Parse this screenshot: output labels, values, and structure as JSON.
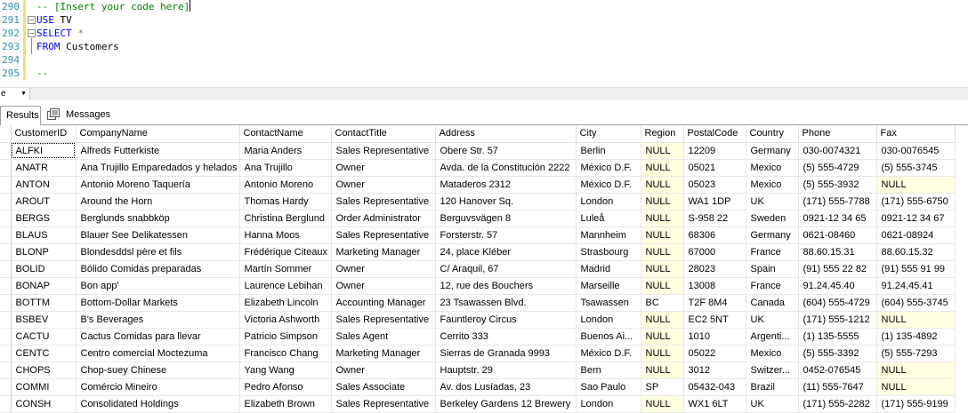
{
  "editor": {
    "lines": [
      {
        "num": "290",
        "parts": [
          {
            "t": "-- [Insert your code here]",
            "c": "cm"
          }
        ],
        "caret": true
      },
      {
        "num": "291",
        "parts": [
          {
            "t": "USE",
            "c": "kw"
          },
          {
            "t": " TV",
            "c": "tx"
          }
        ]
      },
      {
        "num": "292",
        "parts": [
          {
            "t": "SELECT",
            "c": "kw"
          },
          {
            "t": " ",
            "c": "tx"
          },
          {
            "t": "*",
            "c": "op"
          }
        ]
      },
      {
        "num": "293",
        "parts": [
          {
            "t": "FROM",
            "c": "kw"
          },
          {
            "t": " Customers",
            "c": "tx"
          }
        ]
      },
      {
        "num": "294",
        "parts": []
      },
      {
        "num": "295",
        "parts": [
          {
            "t": "--",
            "c": "cm"
          }
        ]
      }
    ],
    "gutter_color": "#f0df79"
  },
  "zoom": {
    "value": "e"
  },
  "tabs": {
    "results_label": "Results",
    "messages_label": "Messages"
  },
  "grid": {
    "columns": [
      "CustomerID",
      "CompanyName",
      "ContactName",
      "ContactTitle",
      "Address",
      "City",
      "Region",
      "PostalCode",
      "Country",
      "Phone",
      "Fax"
    ],
    "rows": [
      [
        "ALFKI",
        "Alfreds Futterkiste",
        "Maria Anders",
        "Sales Representative",
        "Obere Str. 57",
        "Berlin",
        "NULL",
        "12209",
        "Germany",
        "030-0074321",
        "030-0076545"
      ],
      [
        "ANATR",
        "Ana Trujillo Emparedados y helados",
        "Ana Trujillo",
        "Owner",
        "Avda. de la Constitución 2222",
        "México D.F.",
        "NULL",
        "05021",
        "Mexico",
        "(5) 555-4729",
        "(5) 555-3745"
      ],
      [
        "ANTON",
        "Antonio Moreno Taquería",
        "Antonio Moreno",
        "Owner",
        "Mataderos  2312",
        "México D.F.",
        "NULL",
        "05023",
        "Mexico",
        "(5) 555-3932",
        "NULL"
      ],
      [
        "AROUT",
        "Around the Horn",
        "Thomas Hardy",
        "Sales Representative",
        "120 Hanover Sq.",
        "London",
        "NULL",
        "WA1 1DP",
        "UK",
        "(171) 555-7788",
        "(171) 555-6750"
      ],
      [
        "BERGS",
        "Berglunds snabbköp",
        "Christina Berglund",
        "Order Administrator",
        "Berguvsvägen  8",
        "Luleå",
        "NULL",
        "S-958 22",
        "Sweden",
        "0921-12 34 65",
        "0921-12 34 67"
      ],
      [
        "BLAUS",
        "Blauer See Delikatessen",
        "Hanna Moos",
        "Sales Representative",
        "Forsterstr. 57",
        "Mannheim",
        "NULL",
        "68306",
        "Germany",
        "0621-08460",
        "0621-08924"
      ],
      [
        "BLONP",
        "Blondesddsl père et fils",
        "Frédérique Citeaux",
        "Marketing Manager",
        "24, place Kléber",
        "Strasbourg",
        "NULL",
        "67000",
        "France",
        "88.60.15.31",
        "88.60.15.32"
      ],
      [
        "BOLID",
        "Bólido Comidas preparadas",
        "Martín Sommer",
        "Owner",
        "C/ Araquil, 67",
        "Madrid",
        "NULL",
        "28023",
        "Spain",
        "(91) 555 22 82",
        "(91) 555 91 99"
      ],
      [
        "BONAP",
        "Bon app'",
        "Laurence Lebihan",
        "Owner",
        "12, rue des Bouchers",
        "Marseille",
        "NULL",
        "13008",
        "France",
        "91.24.45.40",
        "91.24.45.41"
      ],
      [
        "BOTTM",
        "Bottom-Dollar Markets",
        "Elizabeth Lincoln",
        "Accounting Manager",
        "23 Tsawassen Blvd.",
        "Tsawassen",
        "BC",
        "T2F 8M4",
        "Canada",
        "(604) 555-4729",
        "(604) 555-3745"
      ],
      [
        "BSBEV",
        "B's Beverages",
        "Victoria Ashworth",
        "Sales Representative",
        "Fauntleroy Circus",
        "London",
        "NULL",
        "EC2 5NT",
        "UK",
        "(171) 555-1212",
        "NULL"
      ],
      [
        "CACTU",
        "Cactus Comidas para llevar",
        "Patricio Simpson",
        "Sales Agent",
        "Cerrito 333",
        "Buenos Ai...",
        "NULL",
        "1010",
        "Argenti...",
        "(1) 135-5555",
        "(1) 135-4892"
      ],
      [
        "CENTC",
        "Centro comercial Moctezuma",
        "Francisco Chang",
        "Marketing Manager",
        "Sierras de Granada 9993",
        "México D.F.",
        "NULL",
        "05022",
        "Mexico",
        "(5) 555-3392",
        "(5) 555-7293"
      ],
      [
        "CHOPS",
        "Chop-suey Chinese",
        "Yang Wang",
        "Owner",
        "Hauptstr. 29",
        "Bern",
        "NULL",
        "3012",
        "Switzer...",
        "0452-076545",
        "NULL"
      ],
      [
        "COMMI",
        "Comércio Mineiro",
        "Pedro Afonso",
        "Sales Associate",
        "Av. dos Lusíadas, 23",
        "Sao Paulo",
        "SP",
        "05432-043",
        "Brazil",
        "(11) 555-7647",
        "NULL"
      ],
      [
        "CONSH",
        "Consolidated Holdings",
        "Elizabeth Brown",
        "Sales Representative",
        "Berkeley Gardens 12  Brewery",
        "London",
        "NULL",
        "WX1 6LT",
        "UK",
        "(171) 555-2282",
        "(171) 555-9199"
      ]
    ]
  }
}
